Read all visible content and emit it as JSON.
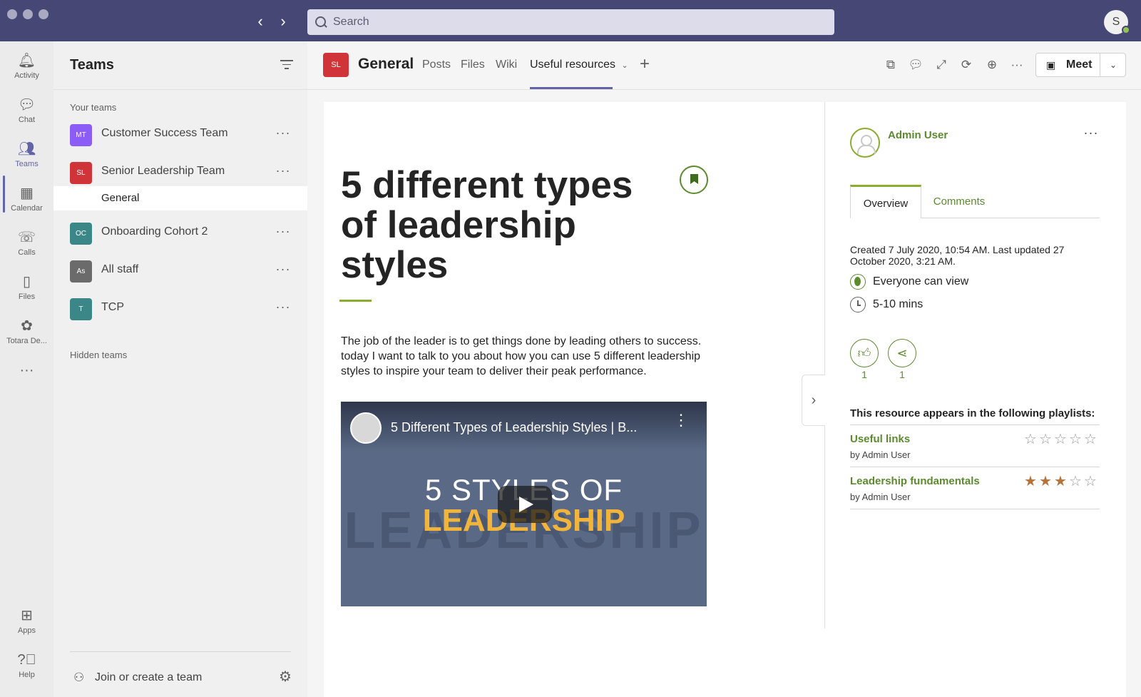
{
  "topbar": {
    "search_placeholder": "Search",
    "profile_initial": "S"
  },
  "rail": {
    "items": [
      {
        "label": "Activity",
        "icon": "bell-icon"
      },
      {
        "label": "Chat",
        "icon": "chat-icon"
      },
      {
        "label": "Teams",
        "icon": "teams-icon"
      },
      {
        "label": "Calendar",
        "icon": "calendar-icon"
      },
      {
        "label": "Calls",
        "icon": "phone-icon"
      },
      {
        "label": "Files",
        "icon": "file-icon"
      },
      {
        "label": "Totara De...",
        "icon": "totara-icon"
      },
      {
        "label": "Apps",
        "icon": "apps-icon"
      },
      {
        "label": "Help",
        "icon": "help-icon"
      }
    ],
    "active": "Teams"
  },
  "teams_pane": {
    "title": "Teams",
    "your_teams_label": "Your teams",
    "teams": [
      {
        "initials": "MT",
        "name": "Customer Success Team",
        "color": "#8b5cf6"
      },
      {
        "initials": "SL",
        "name": "Senior Leadership Team",
        "color": "#d13438"
      },
      {
        "initials": "OC",
        "name": "Onboarding Cohort 2",
        "color": "#3b8686"
      },
      {
        "initials": "As",
        "name": "All staff",
        "color": "#6b6b6b"
      },
      {
        "initials": "T",
        "name": "TCP",
        "color": "#3b8686"
      }
    ],
    "selected_channel": "General",
    "hidden_teams_label": "Hidden teams",
    "join_label": "Join or create a team"
  },
  "channel": {
    "avatar_initials": "SL",
    "title": "General",
    "tabs": [
      "Posts",
      "Files",
      "Wiki",
      "Useful resources"
    ],
    "active_tab": "Useful resources",
    "meet_label": "Meet"
  },
  "resource": {
    "title": "5 different types of leadership styles",
    "description": "The job of the leader is to get things done by leading others to success. today I want to talk to you about how you can use 5 different leadership styles to inspire your team to deliver their peak performance.",
    "video": {
      "title": "5 Different Types of Leadership Styles | B...",
      "line1": "5 STYLES OF",
      "line2": "LEADERSHIP",
      "background_text": "LEADERSHIP"
    }
  },
  "panel": {
    "author": "Admin User",
    "tabs": [
      "Overview",
      "Comments"
    ],
    "active_tab": "Overview",
    "created": "Created 7 July 2020, 10:54 AM. Last updated 27 October 2020, 3:21 AM.",
    "visibility": "Everyone can view",
    "duration": "5-10 mins",
    "likes": "1",
    "shares": "1",
    "playlists_heading": "This resource appears in the following playlists:",
    "playlists": [
      {
        "name": "Useful links",
        "by": "by Admin User",
        "rating": 0
      },
      {
        "name": "Leadership fundamentals",
        "by": "by Admin User",
        "rating": 3
      }
    ],
    "accent_color": "#5c8a2f"
  }
}
